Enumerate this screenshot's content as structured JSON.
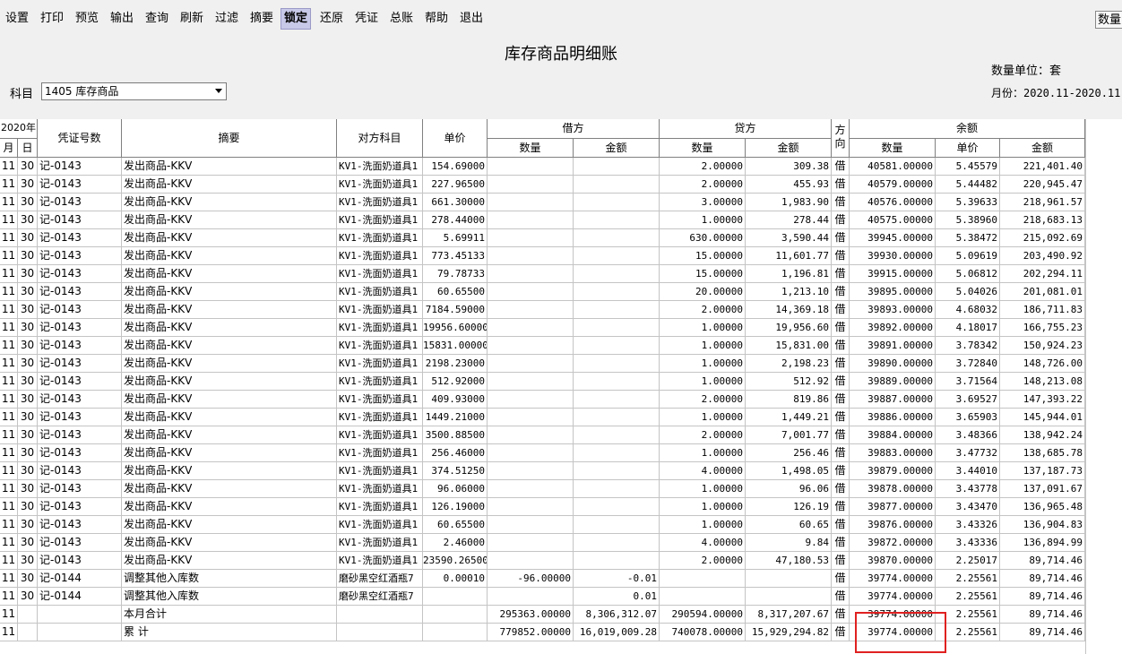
{
  "toolbar": {
    "buttons": [
      "设置",
      "打印",
      "预览",
      "输出",
      "查询",
      "刷新",
      "过滤",
      "摘要",
      "锁定",
      "还原",
      "凭证",
      "总账",
      "帮助",
      "退出"
    ],
    "active": "锁定",
    "qty_button": "数量金"
  },
  "report": {
    "title": "库存商品明细账",
    "unit": "数量单位：套",
    "month": "月份：2020.11-2020.11",
    "subject_label": "科目",
    "subject_value": "1405 库存商品"
  },
  "header": {
    "year": "2020年",
    "month": "月",
    "day": "日",
    "voucher": "凭证号数",
    "summary": "摘要",
    "counterpart": "对方科目",
    "unit_price": "单价",
    "debit": "借方",
    "credit": "贷方",
    "direction": "方向",
    "balance": "余额",
    "qty": "数量",
    "amount": "金额",
    "bal_price": "单价"
  },
  "rows": [
    {
      "m": "11",
      "d": "30",
      "v": "记-0143",
      "s": "发出商品-KKV",
      "cp": "KV1-洗面奶道具1",
      "p": "154.69000",
      "dq": "",
      "da": "",
      "cq": "2.00000",
      "ca": "309.38",
      "dir": "借",
      "bq": "40581.00000",
      "bp": "5.45579",
      "ba": "221,401.40"
    },
    {
      "m": "11",
      "d": "30",
      "v": "记-0143",
      "s": "发出商品-KKV",
      "cp": "KV1-洗面奶道具1",
      "p": "227.96500",
      "dq": "",
      "da": "",
      "cq": "2.00000",
      "ca": "455.93",
      "dir": "借",
      "bq": "40579.00000",
      "bp": "5.44482",
      "ba": "220,945.47"
    },
    {
      "m": "11",
      "d": "30",
      "v": "记-0143",
      "s": "发出商品-KKV",
      "cp": "KV1-洗面奶道具1",
      "p": "661.30000",
      "dq": "",
      "da": "",
      "cq": "3.00000",
      "ca": "1,983.90",
      "dir": "借",
      "bq": "40576.00000",
      "bp": "5.39633",
      "ba": "218,961.57"
    },
    {
      "m": "11",
      "d": "30",
      "v": "记-0143",
      "s": "发出商品-KKV",
      "cp": "KV1-洗面奶道具1",
      "p": "278.44000",
      "dq": "",
      "da": "",
      "cq": "1.00000",
      "ca": "278.44",
      "dir": "借",
      "bq": "40575.00000",
      "bp": "5.38960",
      "ba": "218,683.13"
    },
    {
      "m": "11",
      "d": "30",
      "v": "记-0143",
      "s": "发出商品-KKV",
      "cp": "KV1-洗面奶道具1",
      "p": "5.69911",
      "dq": "",
      "da": "",
      "cq": "630.00000",
      "ca": "3,590.44",
      "dir": "借",
      "bq": "39945.00000",
      "bp": "5.38472",
      "ba": "215,092.69"
    },
    {
      "m": "11",
      "d": "30",
      "v": "记-0143",
      "s": "发出商品-KKV",
      "cp": "KV1-洗面奶道具1",
      "p": "773.45133",
      "dq": "",
      "da": "",
      "cq": "15.00000",
      "ca": "11,601.77",
      "dir": "借",
      "bq": "39930.00000",
      "bp": "5.09619",
      "ba": "203,490.92"
    },
    {
      "m": "11",
      "d": "30",
      "v": "记-0143",
      "s": "发出商品-KKV",
      "cp": "KV1-洗面奶道具1",
      "p": "79.78733",
      "dq": "",
      "da": "",
      "cq": "15.00000",
      "ca": "1,196.81",
      "dir": "借",
      "bq": "39915.00000",
      "bp": "5.06812",
      "ba": "202,294.11"
    },
    {
      "m": "11",
      "d": "30",
      "v": "记-0143",
      "s": "发出商品-KKV",
      "cp": "KV1-洗面奶道具1",
      "p": "60.65500",
      "dq": "",
      "da": "",
      "cq": "20.00000",
      "ca": "1,213.10",
      "dir": "借",
      "bq": "39895.00000",
      "bp": "5.04026",
      "ba": "201,081.01"
    },
    {
      "m": "11",
      "d": "30",
      "v": "记-0143",
      "s": "发出商品-KKV",
      "cp": "KV1-洗面奶道具1",
      "p": "7184.59000",
      "dq": "",
      "da": "",
      "cq": "2.00000",
      "ca": "14,369.18",
      "dir": "借",
      "bq": "39893.00000",
      "bp": "4.68032",
      "ba": "186,711.83"
    },
    {
      "m": "11",
      "d": "30",
      "v": "记-0143",
      "s": "发出商品-KKV",
      "cp": "KV1-洗面奶道具1",
      "p": "19956.60000",
      "dq": "",
      "da": "",
      "cq": "1.00000",
      "ca": "19,956.60",
      "dir": "借",
      "bq": "39892.00000",
      "bp": "4.18017",
      "ba": "166,755.23"
    },
    {
      "m": "11",
      "d": "30",
      "v": "记-0143",
      "s": "发出商品-KKV",
      "cp": "KV1-洗面奶道具1",
      "p": "15831.00000",
      "dq": "",
      "da": "",
      "cq": "1.00000",
      "ca": "15,831.00",
      "dir": "借",
      "bq": "39891.00000",
      "bp": "3.78342",
      "ba": "150,924.23"
    },
    {
      "m": "11",
      "d": "30",
      "v": "记-0143",
      "s": "发出商品-KKV",
      "cp": "KV1-洗面奶道具1",
      "p": "2198.23000",
      "dq": "",
      "da": "",
      "cq": "1.00000",
      "ca": "2,198.23",
      "dir": "借",
      "bq": "39890.00000",
      "bp": "3.72840",
      "ba": "148,726.00"
    },
    {
      "m": "11",
      "d": "30",
      "v": "记-0143",
      "s": "发出商品-KKV",
      "cp": "KV1-洗面奶道具1",
      "p": "512.92000",
      "dq": "",
      "da": "",
      "cq": "1.00000",
      "ca": "512.92",
      "dir": "借",
      "bq": "39889.00000",
      "bp": "3.71564",
      "ba": "148,213.08"
    },
    {
      "m": "11",
      "d": "30",
      "v": "记-0143",
      "s": "发出商品-KKV",
      "cp": "KV1-洗面奶道具1",
      "p": "409.93000",
      "dq": "",
      "da": "",
      "cq": "2.00000",
      "ca": "819.86",
      "dir": "借",
      "bq": "39887.00000",
      "bp": "3.69527",
      "ba": "147,393.22"
    },
    {
      "m": "11",
      "d": "30",
      "v": "记-0143",
      "s": "发出商品-KKV",
      "cp": "KV1-洗面奶道具1",
      "p": "1449.21000",
      "dq": "",
      "da": "",
      "cq": "1.00000",
      "ca": "1,449.21",
      "dir": "借",
      "bq": "39886.00000",
      "bp": "3.65903",
      "ba": "145,944.01"
    },
    {
      "m": "11",
      "d": "30",
      "v": "记-0143",
      "s": "发出商品-KKV",
      "cp": "KV1-洗面奶道具1",
      "p": "3500.88500",
      "dq": "",
      "da": "",
      "cq": "2.00000",
      "ca": "7,001.77",
      "dir": "借",
      "bq": "39884.00000",
      "bp": "3.48366",
      "ba": "138,942.24"
    },
    {
      "m": "11",
      "d": "30",
      "v": "记-0143",
      "s": "发出商品-KKV",
      "cp": "KV1-洗面奶道具1",
      "p": "256.46000",
      "dq": "",
      "da": "",
      "cq": "1.00000",
      "ca": "256.46",
      "dir": "借",
      "bq": "39883.00000",
      "bp": "3.47732",
      "ba": "138,685.78"
    },
    {
      "m": "11",
      "d": "30",
      "v": "记-0143",
      "s": "发出商品-KKV",
      "cp": "KV1-洗面奶道具1",
      "p": "374.51250",
      "dq": "",
      "da": "",
      "cq": "4.00000",
      "ca": "1,498.05",
      "dir": "借",
      "bq": "39879.00000",
      "bp": "3.44010",
      "ba": "137,187.73"
    },
    {
      "m": "11",
      "d": "30",
      "v": "记-0143",
      "s": "发出商品-KKV",
      "cp": "KV1-洗面奶道具1",
      "p": "96.06000",
      "dq": "",
      "da": "",
      "cq": "1.00000",
      "ca": "96.06",
      "dir": "借",
      "bq": "39878.00000",
      "bp": "3.43778",
      "ba": "137,091.67"
    },
    {
      "m": "11",
      "d": "30",
      "v": "记-0143",
      "s": "发出商品-KKV",
      "cp": "KV1-洗面奶道具1",
      "p": "126.19000",
      "dq": "",
      "da": "",
      "cq": "1.00000",
      "ca": "126.19",
      "dir": "借",
      "bq": "39877.00000",
      "bp": "3.43470",
      "ba": "136,965.48"
    },
    {
      "m": "11",
      "d": "30",
      "v": "记-0143",
      "s": "发出商品-KKV",
      "cp": "KV1-洗面奶道具1",
      "p": "60.65500",
      "dq": "",
      "da": "",
      "cq": "1.00000",
      "ca": "60.65",
      "dir": "借",
      "bq": "39876.00000",
      "bp": "3.43326",
      "ba": "136,904.83"
    },
    {
      "m": "11",
      "d": "30",
      "v": "记-0143",
      "s": "发出商品-KKV",
      "cp": "KV1-洗面奶道具1",
      "p": "2.46000",
      "dq": "",
      "da": "",
      "cq": "4.00000",
      "ca": "9.84",
      "dir": "借",
      "bq": "39872.00000",
      "bp": "3.43336",
      "ba": "136,894.99"
    },
    {
      "m": "11",
      "d": "30",
      "v": "记-0143",
      "s": "发出商品-KKV",
      "cp": "KV1-洗面奶道具1",
      "p": "23590.26500",
      "dq": "",
      "da": "",
      "cq": "2.00000",
      "ca": "47,180.53",
      "dir": "借",
      "bq": "39870.00000",
      "bp": "2.25017",
      "ba": "89,714.46"
    },
    {
      "m": "11",
      "d": "30",
      "v": "记-0144",
      "s": "调整其他入库数",
      "cp": "磨砂黑空红酒瓶7",
      "p": "0.00010",
      "dq": "-96.00000",
      "da": "-0.01",
      "cq": "",
      "ca": "",
      "dir": "借",
      "bq": "39774.00000",
      "bp": "2.25561",
      "ba": "89,714.46"
    },
    {
      "m": "11",
      "d": "30",
      "v": "记-0144",
      "s": "调整其他入库数",
      "cp": "磨砂黑空红酒瓶7",
      "p": "",
      "dq": "",
      "da": "0.01",
      "cq": "",
      "ca": "",
      "dir": "借",
      "bq": "39774.00000",
      "bp": "2.25561",
      "ba": "89,714.46"
    },
    {
      "m": "11",
      "d": "",
      "v": "",
      "s": "本月合计",
      "cp": "",
      "p": "",
      "dq": "295363.00000",
      "da": "8,306,312.07",
      "cq": "290594.00000",
      "ca": "8,317,207.67",
      "dir": "借",
      "bq": "39774.00000",
      "bp": "2.25561",
      "ba": "89,714.46"
    },
    {
      "m": "11",
      "d": "",
      "v": "",
      "s": "累    计",
      "cp": "",
      "p": "",
      "dq": "779852.00000",
      "da": "16,019,009.28",
      "cq": "740078.00000",
      "ca": "15,929,294.82",
      "dir": "借",
      "bq": "39774.00000",
      "bp": "2.25561",
      "ba": "89,714.46"
    }
  ]
}
